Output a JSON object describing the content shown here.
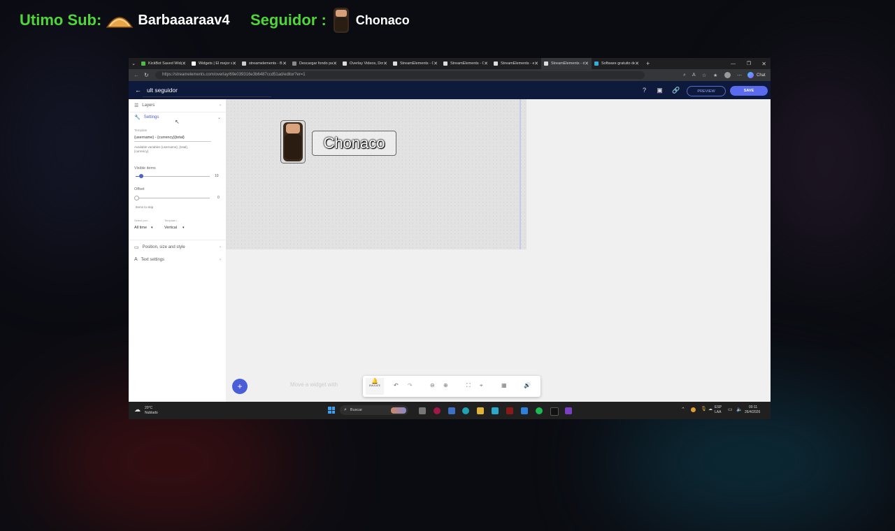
{
  "overlay": {
    "sub_label": "Utimo Sub:",
    "sub_name": "Barbaaaraav4",
    "follower_label": "Seguidor :",
    "follower_name": "Chonaco"
  },
  "browser": {
    "tabs": [
      {
        "label": "KickBot Saved Widg",
        "active": false
      },
      {
        "label": "Widgets | El mejor s",
        "active": false
      },
      {
        "label": "streamelements - B",
        "active": false
      },
      {
        "label": "Descargar fondo pa",
        "active": false
      },
      {
        "label": "Overlay Videos, Dow",
        "active": false
      },
      {
        "label": "StreamElements - O",
        "active": false
      },
      {
        "label": "StreamElements - O",
        "active": false
      },
      {
        "label": "StreamElements - e",
        "active": false
      },
      {
        "label": "StreamElements - d",
        "active": true
      },
      {
        "label": "Software gratuito de",
        "active": false
      }
    ],
    "url": "https://streamelements.com/overlay/69e039316e3b6487ccd51ad/editor?er=1",
    "chat_label": "Chat"
  },
  "editor": {
    "overlay_title": "ult seguidor",
    "preview_label": "PREVIEW",
    "save_label": "SAVE",
    "sidebar": {
      "layers_label": "Layers",
      "settings_label": "Settings",
      "template_label": "Template",
      "template_value": "{username} - {currency}{total}",
      "template_help": "Available variables {username}, {total}, {currency}",
      "visible_items_label": "Visible items",
      "visible_items_value": "10",
      "offset_label": "Offset",
      "offset_value": "0",
      "offset_help": "Items to skip",
      "period_label": "Select peri...",
      "period_value": "All time",
      "template_layout_label": "Template l...",
      "template_layout_value": "Vertical",
      "position_label": "Position, size and style",
      "text_settings_label": "Text settings"
    },
    "canvas": {
      "widget_text": "Chonaco",
      "hint_text": "Move a widget with",
      "emulate_label": "EMULATE"
    }
  },
  "taskbar": {
    "weather_temp": "20°C",
    "weather_desc": "Nublado",
    "search_placeholder": "Buscar",
    "lang_top": "ESP",
    "lang_bottom": "LAA",
    "time": "00:11",
    "date": "26/4/2026"
  },
  "colors": {
    "overlay_green": "#4fd63b",
    "se_header": "#0d1a3b",
    "accent": "#5b6bf0"
  }
}
